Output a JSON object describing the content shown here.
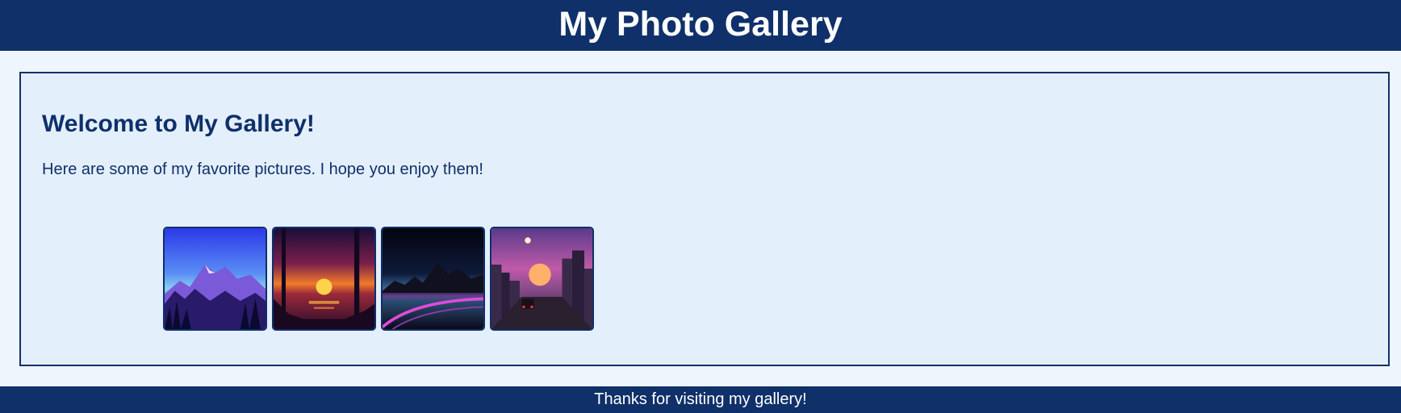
{
  "header": {
    "title": "My Photo Gallery"
  },
  "main": {
    "heading": "Welcome to My Gallery!",
    "intro": "Here are some of my favorite pictures. I hope you enjoy them!"
  },
  "gallery": {
    "images": [
      {
        "subject": "mountain-landscape"
      },
      {
        "subject": "sunset-lake"
      },
      {
        "subject": "neon-road-mountains"
      },
      {
        "subject": "city-street-sunset"
      }
    ]
  },
  "footer": {
    "text": "Thanks for visiting my gallery!"
  },
  "colors": {
    "header_bg": "#0f3069",
    "page_bg": "#eef5fd",
    "panel_bg": "#e4effc",
    "text": "#0f3069"
  }
}
